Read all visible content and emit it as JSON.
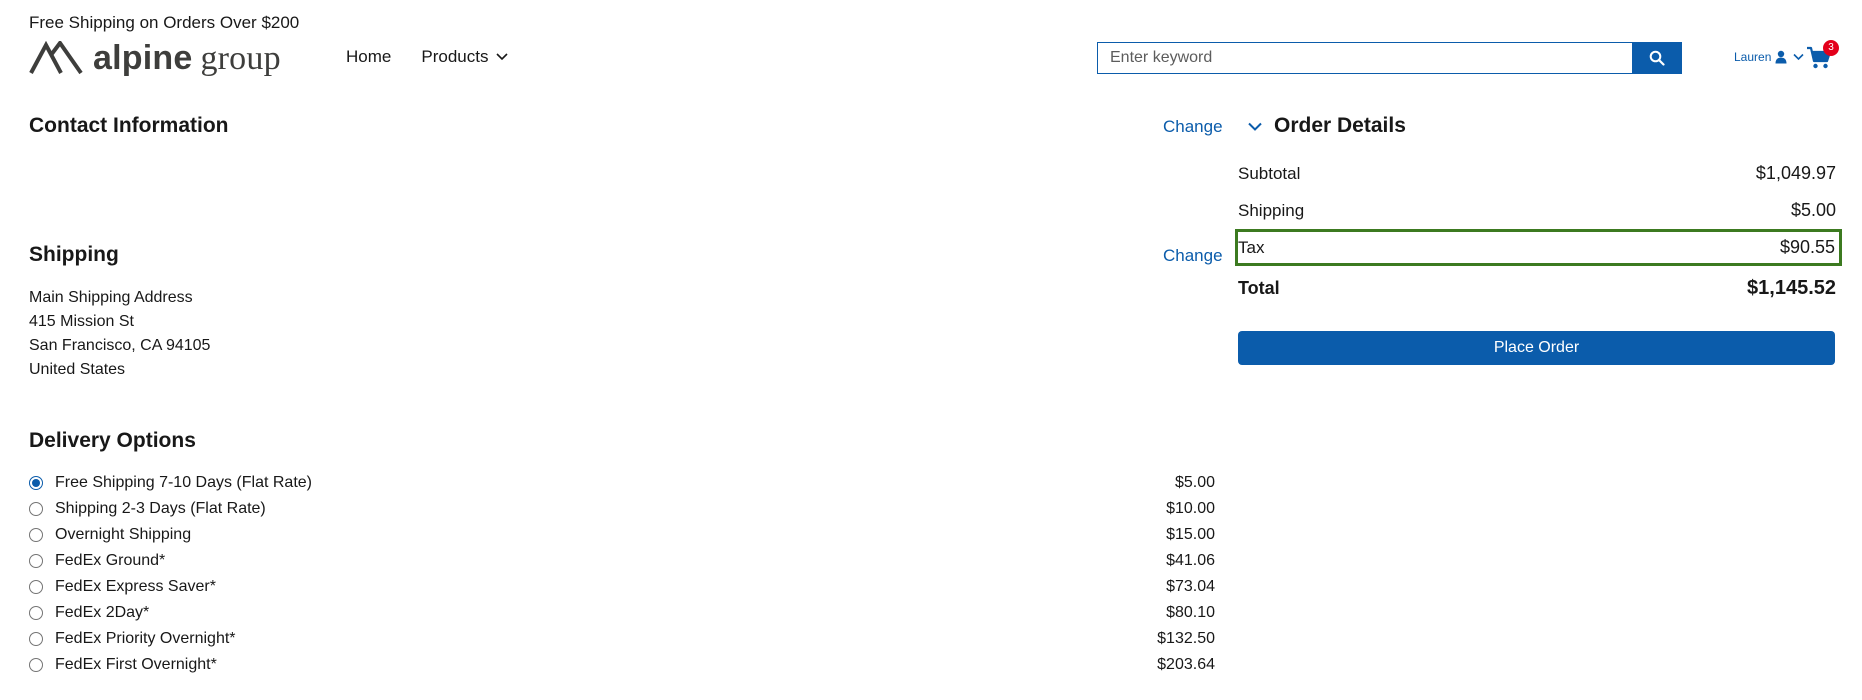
{
  "header": {
    "promo": "Free Shipping on Orders Over $200",
    "logo": {
      "brand_bold": "alpine",
      "brand_light": "group"
    },
    "nav": {
      "home": "Home",
      "products": "Products"
    },
    "search": {
      "placeholder": "Enter keyword"
    },
    "user": {
      "name": "Lauren"
    },
    "cart": {
      "count": "3"
    }
  },
  "contact": {
    "title": "Contact Information",
    "change": "Change"
  },
  "shipping": {
    "title": "Shipping",
    "change": "Change",
    "address": [
      "Main Shipping Address",
      "415 Mission St",
      "San Francisco, CA 94105",
      "United States"
    ]
  },
  "delivery": {
    "title": "Delivery Options",
    "options": [
      {
        "label": "Free Shipping 7-10 Days (Flat Rate)",
        "price": "$5.00",
        "selected": true
      },
      {
        "label": "Shipping 2-3 Days (Flat Rate)",
        "price": "$10.00",
        "selected": false
      },
      {
        "label": "Overnight Shipping",
        "price": "$15.00",
        "selected": false
      },
      {
        "label": "FedEx Ground*",
        "price": "$41.06",
        "selected": false
      },
      {
        "label": "FedEx Express Saver*",
        "price": "$73.04",
        "selected": false
      },
      {
        "label": "FedEx 2Day*",
        "price": "$80.10",
        "selected": false
      },
      {
        "label": "FedEx Priority Overnight*",
        "price": "$132.50",
        "selected": false
      },
      {
        "label": "FedEx First Overnight*",
        "price": "$203.64",
        "selected": false
      }
    ]
  },
  "order": {
    "title": "Order Details",
    "subtotal": {
      "label": "Subtotal",
      "value": "$1,049.97"
    },
    "shipping": {
      "label": "Shipping",
      "value": "$5.00"
    },
    "tax": {
      "label": "Tax",
      "value": "$90.55"
    },
    "total": {
      "label": "Total",
      "value": "$1,145.52"
    },
    "place_order": "Place Order"
  },
  "colors": {
    "accent": "#0b5cab",
    "highlight_border": "#3c7a20",
    "badge": "#e3001b"
  }
}
